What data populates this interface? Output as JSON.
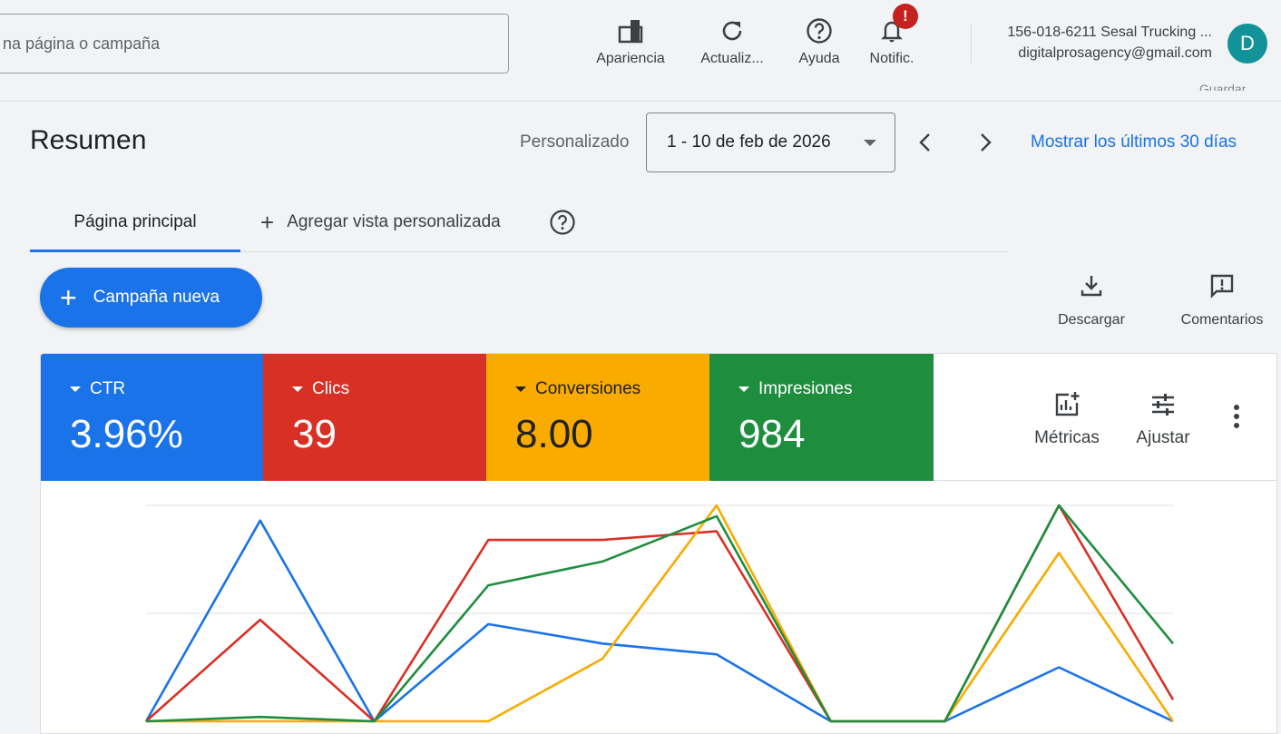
{
  "search": {
    "placeholder": "na página o campaña"
  },
  "toolbar": {
    "appearance_label": "Apariencia",
    "refresh_label": "Actualiz...",
    "help_label": "Ayuda",
    "notifications_label": "Notific.",
    "notifications_badge": "!"
  },
  "account": {
    "name": "156-018-6211 Sesal Trucking ...",
    "email": "digitalprosagency@gmail.com",
    "avatar_letter": "D",
    "cut_text": "Guardar"
  },
  "header": {
    "title": "Resumen",
    "period_label": "Personalizado",
    "date_range": "1 - 10 de feb de 2026",
    "show_last_30": "Mostrar los últimos 30 días"
  },
  "tabs": {
    "main": "Página principal",
    "add_view": "Agregar vista personalizada"
  },
  "actions": {
    "new_campaign": "Campaña nueva",
    "download": "Descargar",
    "comments": "Comentarios"
  },
  "metrics": [
    {
      "name": "CTR",
      "value": "3.96%",
      "color": "#1a73e8"
    },
    {
      "name": "Clics",
      "value": "39",
      "color": "#d93025"
    },
    {
      "name": "Conversiones",
      "value": "8.00",
      "color": "#f9ab00"
    },
    {
      "name": "Impresiones",
      "value": "984",
      "color": "#1e8e3e"
    }
  ],
  "card_tools": {
    "metrics_label": "Métricas",
    "adjust_label": "Ajustar"
  },
  "chart_data": {
    "type": "line",
    "x": [
      1,
      2,
      3,
      4,
      5,
      6,
      7,
      8,
      9,
      10
    ],
    "ylim": [
      0,
      1
    ],
    "grid": true,
    "series": [
      {
        "color": "#1a73e8",
        "values": [
          0.0,
          0.93,
          0.0,
          0.45,
          0.36,
          0.31,
          0.0,
          0.0,
          0.25,
          0.0
        ]
      },
      {
        "color": "#d93025",
        "values": [
          0.0,
          0.47,
          0.0,
          0.84,
          0.84,
          0.88,
          0.0,
          0.0,
          1.0,
          0.1
        ]
      },
      {
        "color": "#f9ab00",
        "values": [
          0.0,
          0.0,
          0.0,
          0.0,
          0.29,
          1.0,
          0.0,
          0.0,
          0.78,
          0.0
        ]
      },
      {
        "color": "#1e8e3e",
        "values": [
          0.0,
          0.02,
          0.0,
          0.63,
          0.74,
          0.95,
          0.0,
          0.0,
          1.0,
          0.36
        ]
      }
    ]
  }
}
